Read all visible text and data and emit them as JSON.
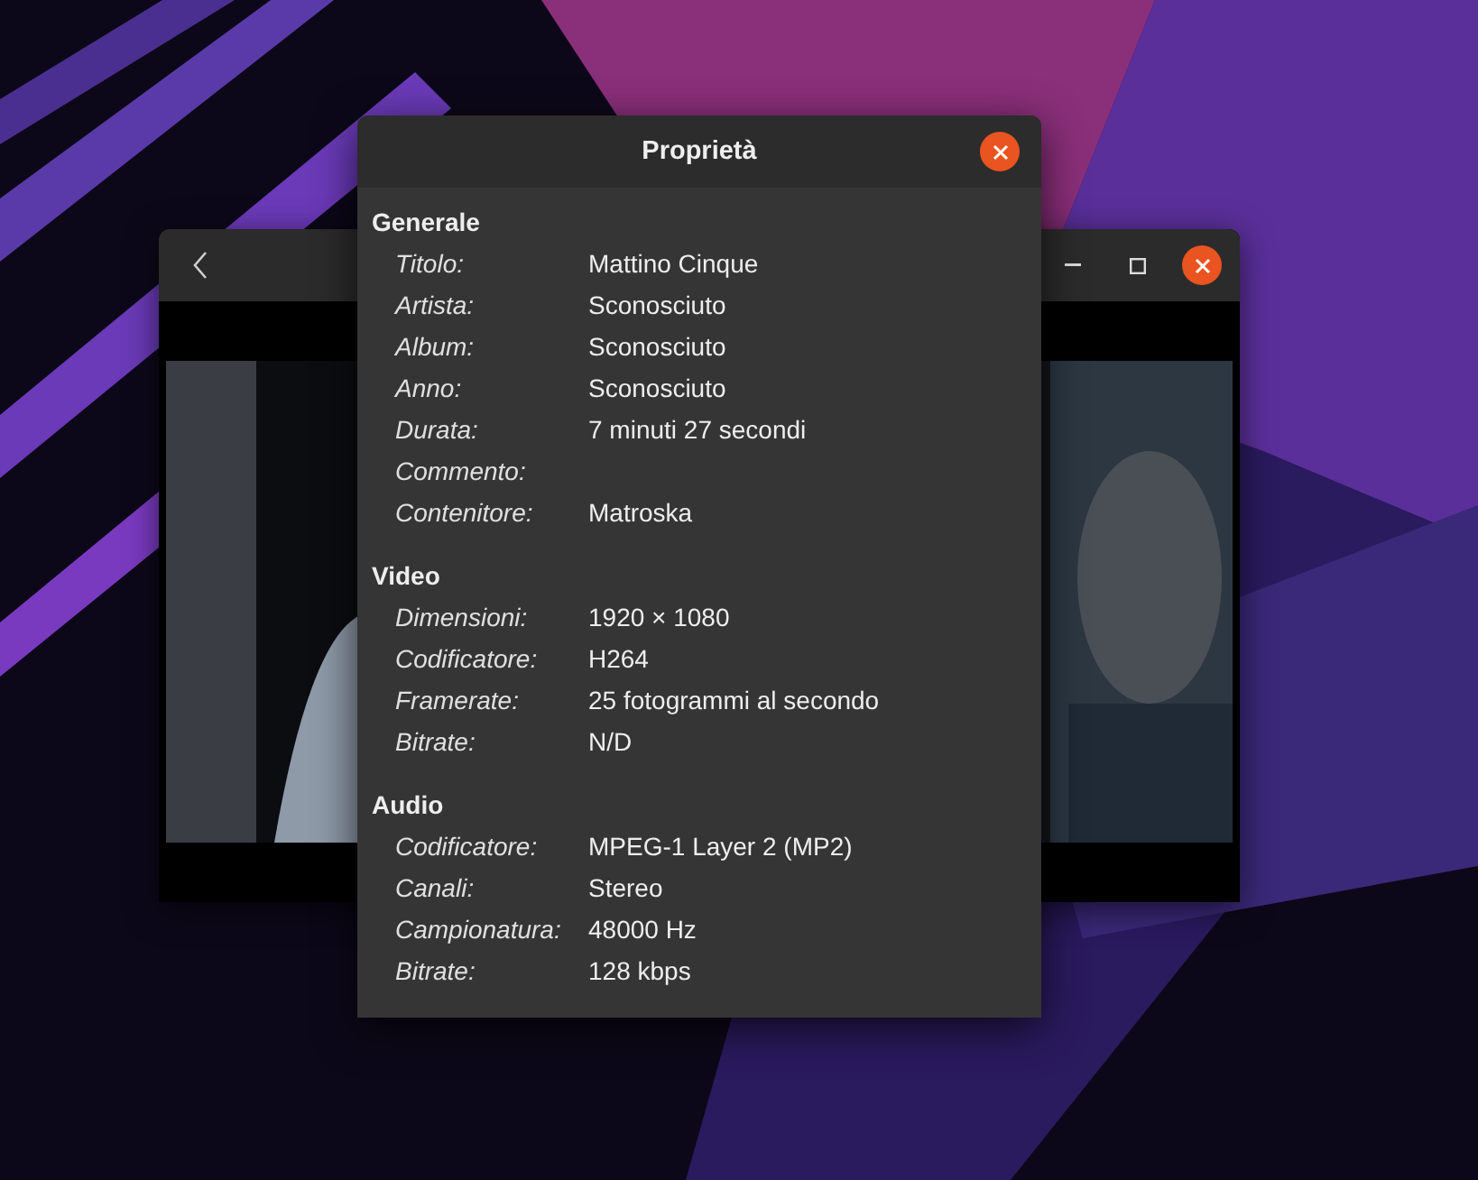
{
  "dialog": {
    "title": "Proprietà",
    "sections": [
      {
        "title": "Generale",
        "fields": [
          {
            "label": "Titolo:",
            "value": "Mattino Cinque"
          },
          {
            "label": "Artista:",
            "value": "Sconosciuto"
          },
          {
            "label": "Album:",
            "value": "Sconosciuto"
          },
          {
            "label": "Anno:",
            "value": "Sconosciuto"
          },
          {
            "label": "Durata:",
            "value": "7 minuti 27 secondi"
          },
          {
            "label": "Commento:"
          },
          {
            "label": "Contenitore:",
            "value": "Matroska"
          }
        ]
      },
      {
        "title": "Video",
        "fields": [
          {
            "label": "Dimensioni:",
            "value": "1920 × 1080"
          },
          {
            "label": "Codificatore:",
            "value": "H264"
          },
          {
            "label": "Framerate:",
            "value": "25 fotogrammi al secondo"
          },
          {
            "label": "Bitrate:",
            "value": "N/D"
          }
        ]
      },
      {
        "title": "Audio",
        "fields": [
          {
            "label": "Codificatore:",
            "value": "MPEG-1 Layer 2 (MP2)"
          },
          {
            "label": "Canali:",
            "value": "Stereo"
          },
          {
            "label": "Campionatura:",
            "value": "48000 Hz"
          },
          {
            "label": "Bitrate:",
            "value": "128 kbps"
          }
        ]
      }
    ]
  }
}
